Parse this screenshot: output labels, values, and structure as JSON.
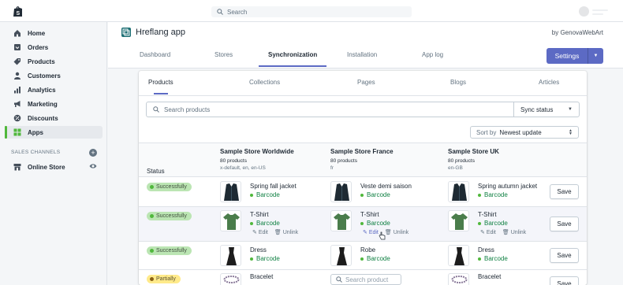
{
  "topbar": {
    "search_placeholder": "Search"
  },
  "sidebar": {
    "items": [
      {
        "label": "Home",
        "icon": "home-icon"
      },
      {
        "label": "Orders",
        "icon": "orders-icon"
      },
      {
        "label": "Products",
        "icon": "tag-icon"
      },
      {
        "label": "Customers",
        "icon": "person-icon"
      },
      {
        "label": "Analytics",
        "icon": "bar-chart-icon"
      },
      {
        "label": "Marketing",
        "icon": "megaphone-icon"
      },
      {
        "label": "Discounts",
        "icon": "discount-icon"
      },
      {
        "label": "Apps",
        "icon": "apps-icon"
      }
    ],
    "channels_label": "SALES CHANNELS",
    "channel_item": "Online Store"
  },
  "app": {
    "title": "Hreflang app",
    "by": "by GenovaWebArt",
    "tabs": [
      "Dashboard",
      "Stores",
      "Synchronization",
      "Installation",
      "App log"
    ],
    "active_tab": "Synchronization",
    "settings_label": "Settings"
  },
  "card": {
    "subtabs": [
      "Products",
      "Collections",
      "Pages",
      "Blogs",
      "Articles"
    ],
    "active_subtab": "Products",
    "search_placeholder": "Search products",
    "sync_status_label": "Sync status",
    "sort_by_label": "Sort by",
    "sort_value": "Newest update"
  },
  "table": {
    "status_header": "Status",
    "stores": [
      {
        "name": "Sample Store Worldwide",
        "count": "80 products",
        "locales": "x-default, en, en-US"
      },
      {
        "name": "Sample Store France",
        "count": "80 products",
        "locales": "fr"
      },
      {
        "name": "Sample Store UK",
        "count": "80 products",
        "locales": "en-GB"
      }
    ],
    "rows": [
      {
        "status": "Successfully",
        "status_kind": "ok",
        "cells": [
          {
            "name": "Spring fall jacket",
            "barcode": "Barcode",
            "thumb": "jacket"
          },
          {
            "name": "Veste demi saison",
            "barcode": "Barcode",
            "thumb": "jacket"
          },
          {
            "name": "Spring autumn jacket",
            "barcode": "Barcode",
            "thumb": "jacket"
          }
        ],
        "save": "Save"
      },
      {
        "status": "Successfully",
        "status_kind": "ok",
        "cells": [
          {
            "name": "T-Shirt",
            "barcode": "Barcode",
            "thumb": "tshirt",
            "edit": "Edit",
            "unlink": "Unlink"
          },
          {
            "name": "T-Shirt",
            "barcode": "Barcode",
            "thumb": "tshirt",
            "edit": "Edit",
            "unlink": "Unlink"
          },
          {
            "name": "T-Shirt",
            "barcode": "Barcode",
            "thumb": "tshirt",
            "edit": "Edit",
            "unlink": "Unlink"
          }
        ],
        "save": "Save"
      },
      {
        "status": "Successfully",
        "status_kind": "ok",
        "cells": [
          {
            "name": "Dress",
            "barcode": "Barcode",
            "thumb": "dress"
          },
          {
            "name": "Robe",
            "barcode": "Barcode",
            "thumb": "dress"
          },
          {
            "name": "Dress",
            "barcode": "Barcode",
            "thumb": "dress"
          }
        ],
        "save": "Save"
      },
      {
        "status": "Partially",
        "status_kind": "partial",
        "cells": [
          {
            "name": "Bracelet",
            "thumb": "bracelet"
          },
          {
            "search_placeholder": "Search product"
          },
          {
            "name": "Bracelet",
            "thumb": "bracelet"
          }
        ],
        "save": "Save"
      }
    ]
  },
  "colors": {
    "accent": "#5c6ac4",
    "success": "#50b83c",
    "barcode": "#108043",
    "partial": "#ffea8a"
  }
}
